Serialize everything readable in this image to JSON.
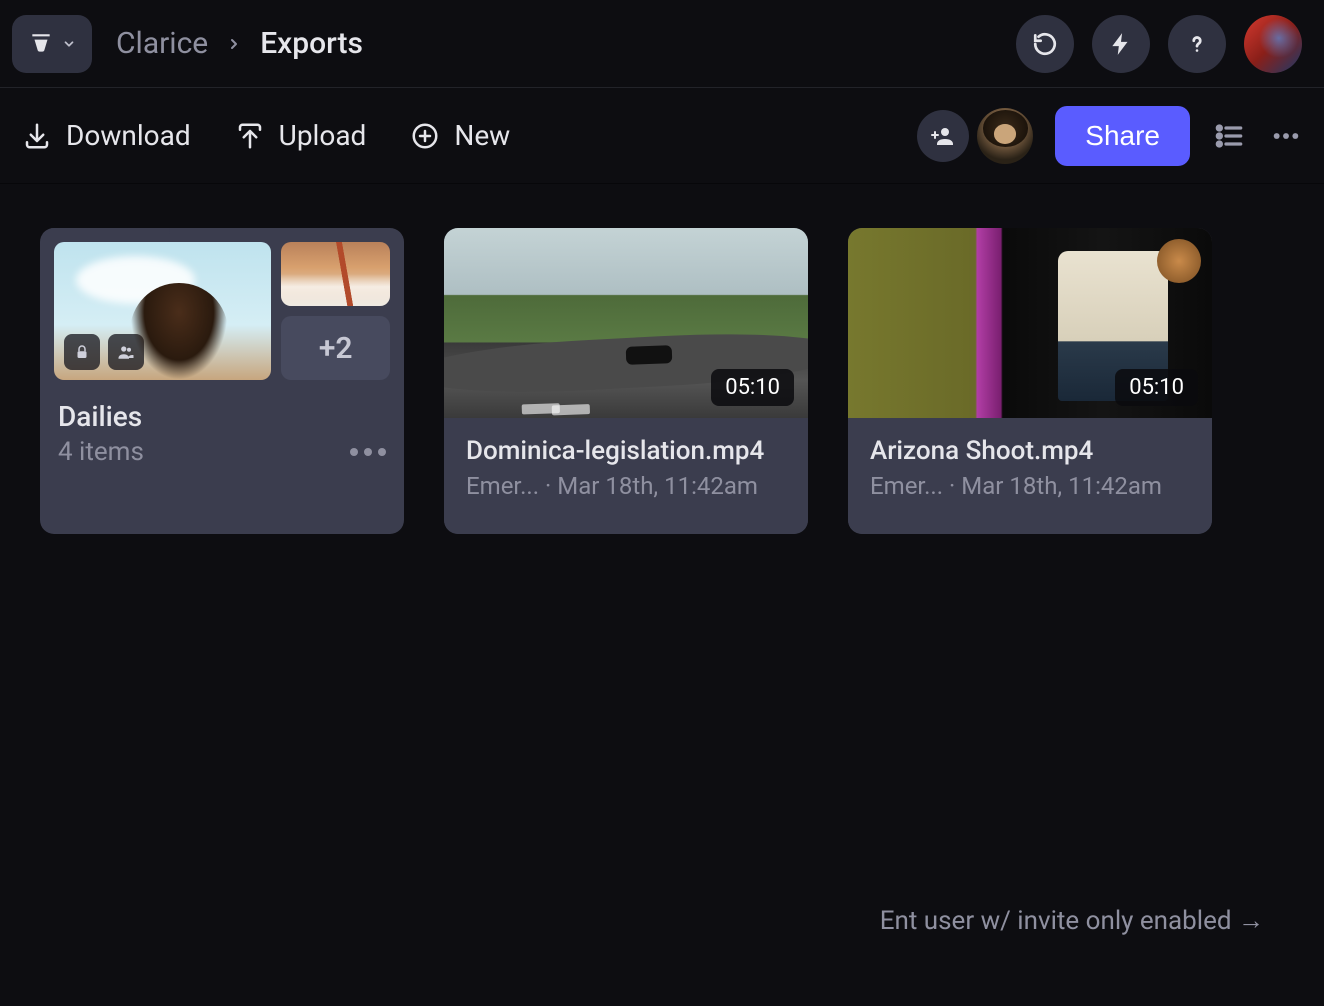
{
  "breadcrumb": {
    "parent": "Clarice",
    "current": "Exports"
  },
  "actions": {
    "download": "Download",
    "upload": "Upload",
    "new": "New",
    "share": "Share"
  },
  "folder": {
    "name": "Dailies",
    "item_count_label": "4 items",
    "more_count": "+2"
  },
  "files": [
    {
      "name": "Dominica-legislation.mp4",
      "uploader": "Emer...",
      "sep": " · ",
      "timestamp": "Mar 18th, 11:42am",
      "duration": "05:10"
    },
    {
      "name": "Arizona Shoot.mp4",
      "uploader": "Emer...",
      "sep": " · ",
      "timestamp": "Mar 18th, 11:42am",
      "duration": "05:10"
    }
  ],
  "footer_hint": "Ent user w/ invite only enabled →"
}
